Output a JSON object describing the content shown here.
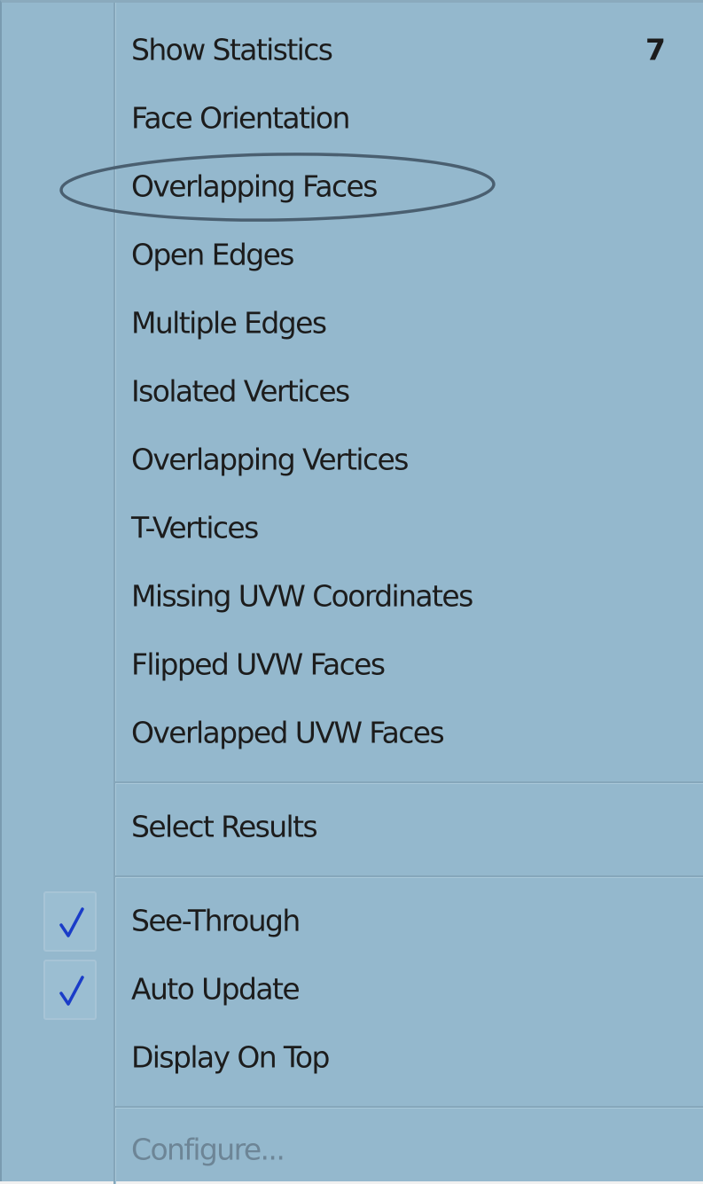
{
  "menu": {
    "items": [
      {
        "label": "Show Statistics",
        "shortcut": "7"
      },
      {
        "label": "Face Orientation"
      },
      {
        "label": "Overlapping Faces"
      },
      {
        "label": "Open Edges"
      },
      {
        "label": "Multiple Edges"
      },
      {
        "label": "Isolated Vertices"
      },
      {
        "label": "Overlapping Vertices"
      },
      {
        "label": "T-Vertices"
      },
      {
        "label": "Missing UVW Coordinates"
      },
      {
        "label": "Flipped UVW Faces"
      },
      {
        "label": "Overlapped UVW Faces"
      },
      {
        "label": "Select Results"
      },
      {
        "label": "See-Through",
        "checked": true
      },
      {
        "label": "Auto Update",
        "checked": true
      },
      {
        "label": "Display On Top"
      },
      {
        "label": "Configure...",
        "disabled": true
      }
    ]
  },
  "highlighted_item": "Overlapping Faces",
  "colors": {
    "menu_background": "#94b8cd",
    "check_mark": "#1a3cc8",
    "annotation_ellipse": "#4a5f70",
    "disabled_text": "#6d8596"
  },
  "icons": {
    "check": "check-icon"
  }
}
